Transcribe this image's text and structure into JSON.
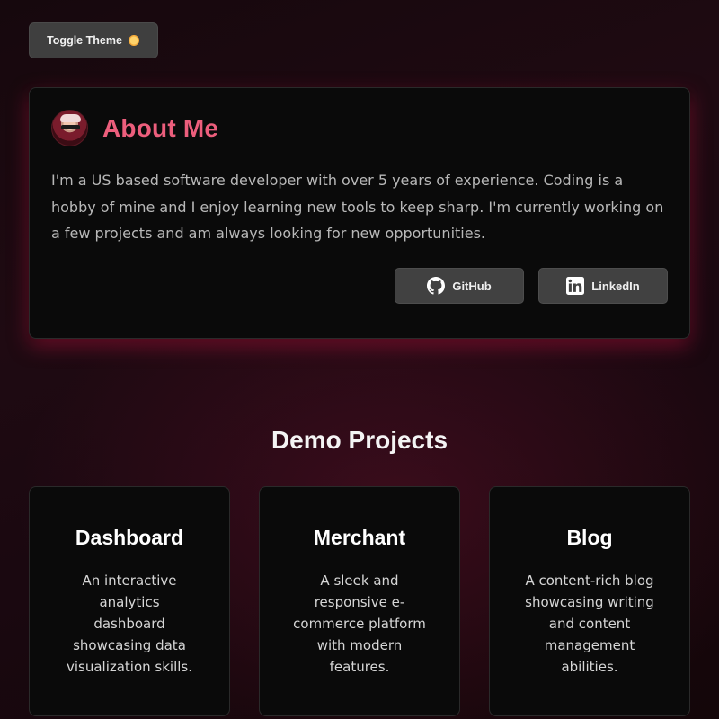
{
  "toggle": {
    "label": "Toggle Theme",
    "icon": "sun-icon"
  },
  "about": {
    "title": "About Me",
    "text": "I'm a US based software developer with over 5 years of experience. Coding is a hobby of mine and I enjoy learning new tools to keep sharp. I'm currently working on a few projects and am always looking for new opportunities.",
    "links": [
      {
        "label": "GitHub",
        "icon": "github-icon"
      },
      {
        "label": "LinkedIn",
        "icon": "linkedin-icon"
      }
    ]
  },
  "projects": {
    "title": "Demo Projects",
    "items": [
      {
        "title": "Dashboard",
        "description": "An interactive analytics dashboard showcasing data visualization skills."
      },
      {
        "title": "Merchant",
        "description": "A sleek and responsive e-commerce platform with modern features."
      },
      {
        "title": "Blog",
        "description": "A content-rich blog showcasing writing and content management abilities."
      }
    ]
  },
  "colors": {
    "accent": "#ec5e7c",
    "card": "#0a0a0a",
    "button": "#414141"
  }
}
